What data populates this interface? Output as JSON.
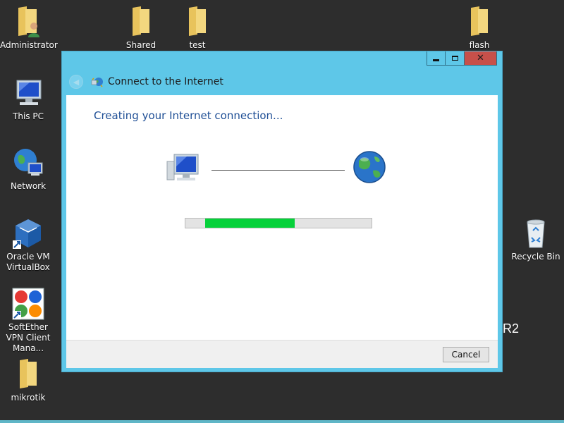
{
  "desktop": {
    "icons": [
      {
        "label": "Administrator",
        "icon": "user-folder-icon"
      },
      {
        "label": "Shared",
        "icon": "folder-icon"
      },
      {
        "label": "test",
        "icon": "folder-icon"
      },
      {
        "label": "flash",
        "icon": "folder-icon"
      },
      {
        "label": "This PC",
        "icon": "computer-icon"
      },
      {
        "label": "Network",
        "icon": "network-icon"
      },
      {
        "label": "Oracle VM VirtualBox",
        "icon": "virtualbox-icon"
      },
      {
        "label": "SoftEther VPN Client Mana...",
        "icon": "softether-icon"
      },
      {
        "label": "mikrotik",
        "icon": "folder-icon"
      },
      {
        "label": "Recycle Bin",
        "icon": "recycle-bin-icon"
      }
    ],
    "corner_text": "R2"
  },
  "window": {
    "title": "Connect to the Internet",
    "heading": "Creating your Internet connection...",
    "progress_fraction": 0.47,
    "cancel_label": "Cancel",
    "accent_color": "#5ec7e8",
    "progress_color": "#06d13a",
    "close_color": "#c7504a"
  }
}
